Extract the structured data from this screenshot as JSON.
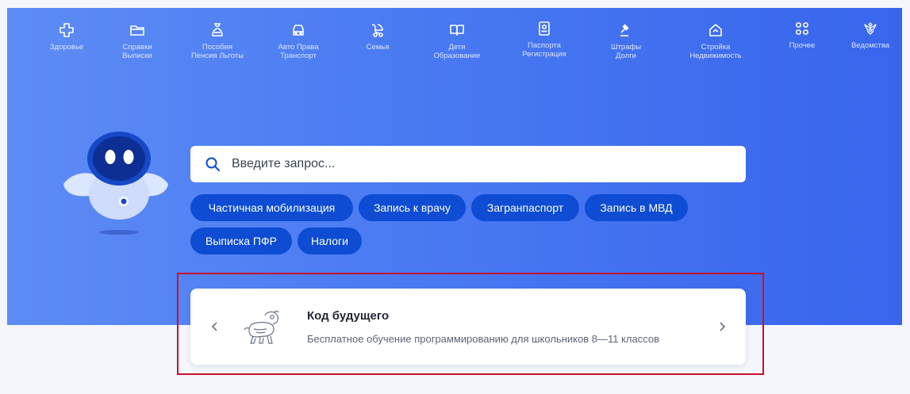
{
  "nav": {
    "items": [
      {
        "label": "Здоровье",
        "icon": "health-cross-icon"
      },
      {
        "label": "Справки\nВыписки",
        "icon": "folder-icon"
      },
      {
        "label": "Пособия\nПенсия Льготы",
        "icon": "money-bag-icon"
      },
      {
        "label": "Авто Права\nТранспорт",
        "icon": "car-icon"
      },
      {
        "label": "Семья",
        "icon": "stroller-icon"
      },
      {
        "label": "Дети\nОбразование",
        "icon": "book-icon"
      },
      {
        "label": "Паспорта\nРегистрация",
        "icon": "passport-icon"
      },
      {
        "label": "Штрафы\nДолги",
        "icon": "gavel-icon"
      },
      {
        "label": "Стройка\nНедвижимость",
        "icon": "house-icon"
      },
      {
        "label": "Прочее",
        "icon": "grid-icon"
      },
      {
        "label": "Ведомства",
        "icon": "coat-of-arms-icon"
      }
    ]
  },
  "search": {
    "placeholder": "Введите запрос..."
  },
  "chips": [
    "Частичная мобилизация",
    "Запись к врачу",
    "Загранпаспорт",
    "Запись в МВД",
    "Выписка ПФР",
    "Налоги"
  ],
  "card": {
    "title": "Код будущего",
    "subtitle": "Бесплатное обучение программированию для школьников 8—11 классов"
  },
  "colors": {
    "hero": "#4a7af2",
    "chip": "#0d4cd3",
    "highlight": "#c8102e"
  }
}
